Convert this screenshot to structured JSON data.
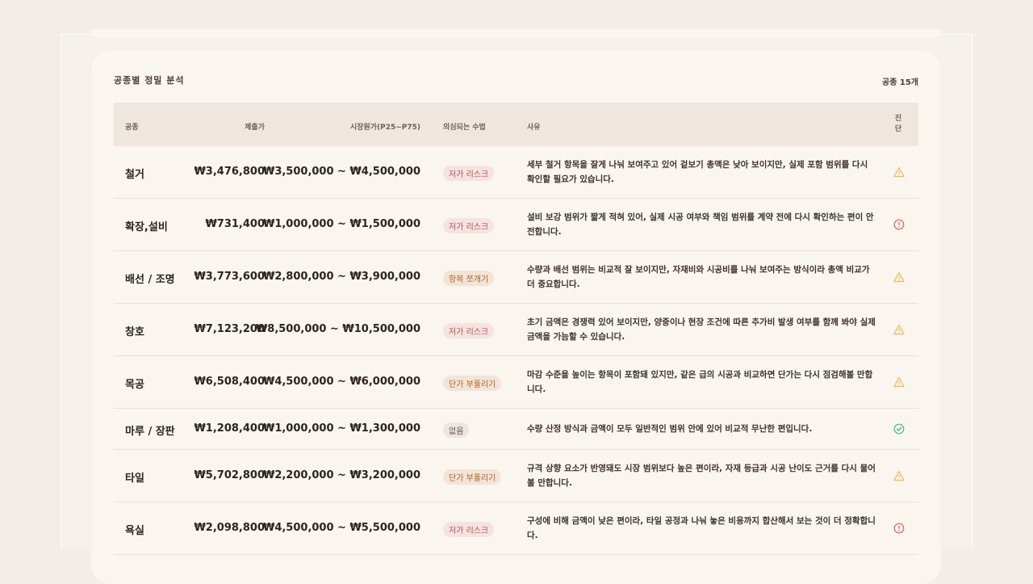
{
  "section": {
    "title": "공종별 정밀 분석",
    "count": "공종 15개"
  },
  "columns": {
    "trade": "공종",
    "price": "제출가",
    "market": "시장원가(P25~P75)",
    "method": "의심되는 수법",
    "reason": "사유",
    "diagnosis": "진단"
  },
  "colors": {
    "warning": "#f0b75a",
    "danger": "#e06060",
    "ok": "#3fbf74"
  },
  "rows": [
    {
      "trade": "철거",
      "price": "₩3,476,800",
      "market": "₩3,500,000 ~ ₩4,500,000",
      "method": "저가 리스크",
      "method_type": "low",
      "reason": "세부 철거 항목을 잘게 나눠 보여주고 있어 겉보기 총액은 낮아 보이지만, 실제 포함 범위를 다시 확인할 필요가 있습니다.",
      "diagnosis_icon": "warning-icon"
    },
    {
      "trade": "확장,설비",
      "price": "₩731,400",
      "market": "₩1,000,000 ~ ₩1,500,000",
      "method": "저가 리스크",
      "method_type": "low",
      "reason": "설비 보강 범위가 짧게 적혀 있어, 실제 시공 여부와 책임 범위를 계약 전에 다시 확인하는 편이 안전합니다.",
      "diagnosis_icon": "danger-icon"
    },
    {
      "trade": "배선 / 조명",
      "price": "₩3,773,600",
      "market": "₩2,800,000 ~ ₩3,900,000",
      "method": "항목 쪼개기",
      "method_type": "split",
      "reason": "수량과 배선 범위는 비교적 잘 보이지만, 자재비와 시공비를 나눠 보여주는 방식이라 총액 비교가 더 중요합니다.",
      "diagnosis_icon": "warning-icon"
    },
    {
      "trade": "창호",
      "price": "₩7,123,200",
      "market": "₩8,500,000 ~ ₩10,500,000",
      "method": "저가 리스크",
      "method_type": "low",
      "reason": "초기 금액은 경쟁력 있어 보이지만, 양중이나 현장 조건에 따른 추가비 발생 여부를 함께 봐야 실제 금액을 가늠할 수 있습니다.",
      "diagnosis_icon": "warning-icon"
    },
    {
      "trade": "목공",
      "price": "₩6,508,400",
      "market": "₩4,500,000 ~ ₩6,000,000",
      "method": "단가 부풀리기",
      "method_type": "inflate",
      "reason": "마감 수준을 높이는 항목이 포함돼 있지만, 같은 급의 시공과 비교하면 단가는 다시 점검해볼 만합니다.",
      "diagnosis_icon": "warning-icon"
    },
    {
      "trade": "마루 / 장판",
      "price": "₩1,208,400",
      "market": "₩1,000,000 ~ ₩1,300,000",
      "method": "없음",
      "method_type": "none",
      "reason": "수량 산정 방식과 금액이 모두 일반적인 범위 안에 있어 비교적 무난한 편입니다.",
      "diagnosis_icon": "ok-icon"
    },
    {
      "trade": "타일",
      "price": "₩5,702,800",
      "market": "₩2,200,000 ~ ₩3,200,000",
      "method": "단가 부풀리기",
      "method_type": "inflate",
      "reason": "규격 상향 요소가 반영돼도 시장 범위보다 높은 편이라, 자재 등급과 시공 난이도 근거를 다시 물어볼 만합니다.",
      "diagnosis_icon": "warning-icon"
    },
    {
      "trade": "욕실",
      "price": "₩2,098,800",
      "market": "₩4,500,000 ~ ₩5,500,000",
      "method": "저가 리스크",
      "method_type": "low",
      "reason": "구성에 비해 금액이 낮은 편이라, 타일 공정과 나눠 놓은 비용까지 합산해서 보는 것이 더 정확합니다.",
      "diagnosis_icon": "danger-icon"
    }
  ]
}
